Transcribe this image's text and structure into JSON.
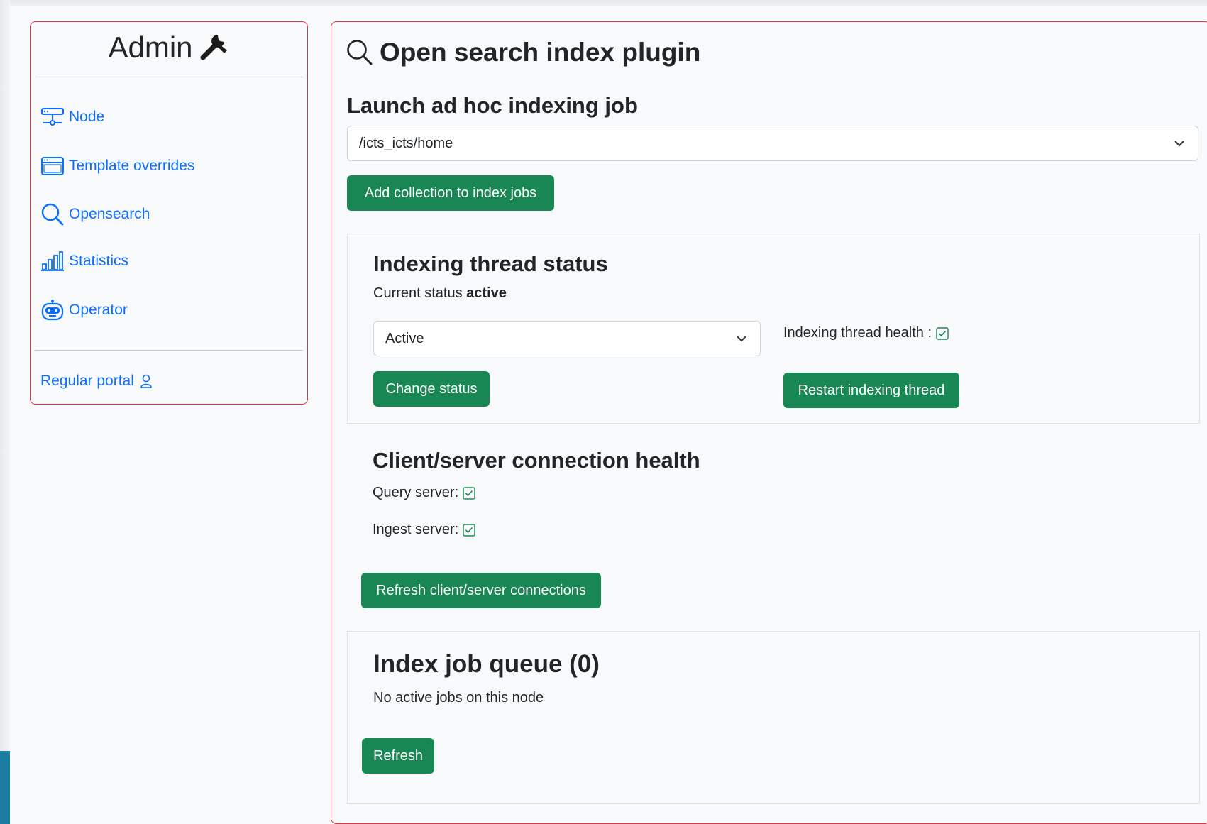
{
  "sidebar": {
    "title": "Admin",
    "items": [
      {
        "label": "Node",
        "icon": "server-icon"
      },
      {
        "label": "Template overrides",
        "icon": "window-icon"
      },
      {
        "label": "Opensearch",
        "icon": "search-icon"
      },
      {
        "label": "Statistics",
        "icon": "bar-chart-icon"
      },
      {
        "label": "Operator",
        "icon": "robot-icon"
      }
    ],
    "portal_label": "Regular portal"
  },
  "main": {
    "title": "Open search index plugin",
    "launch_heading": "Launch ad hoc indexing job",
    "collection_select_value": "/icts_icts/home",
    "add_collection_button": "Add collection to index jobs",
    "thread_status": {
      "heading": "Indexing thread status",
      "current_status_label": "Current status",
      "current_status_value": "active",
      "status_select_value": "Active",
      "change_status_button": "Change status",
      "health_label": "Indexing thread health :",
      "restart_button": "Restart indexing thread"
    },
    "connection": {
      "heading": "Client/server connection health",
      "query_label": "Query server:",
      "ingest_label": "Ingest server:",
      "refresh_button": "Refresh client/server connections"
    },
    "queue": {
      "heading": "Index job queue (0)",
      "empty_text": "No active jobs on this node",
      "refresh_button": "Refresh"
    }
  },
  "colors": {
    "link": "#0d6efd",
    "button": "#198754",
    "border_accent": "#dc3545",
    "check": "#198754"
  }
}
